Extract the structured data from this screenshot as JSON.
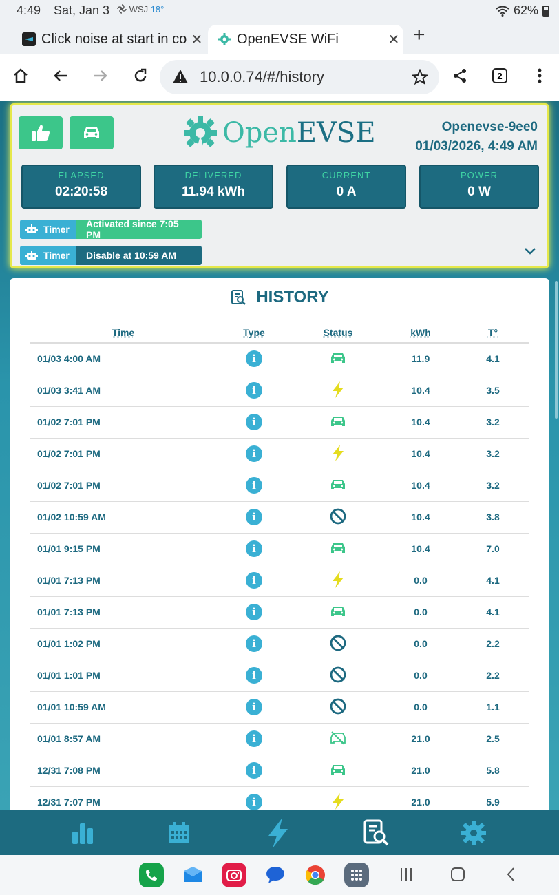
{
  "status_bar": {
    "time": "4:49",
    "date": "Sat, Jan 3",
    "weather_source": "WSJ",
    "temperature": "18°",
    "battery": "62%"
  },
  "tabs": [
    {
      "title": "Click noise at start in co",
      "active": false
    },
    {
      "title": "OpenEVSE WiFi",
      "active": true
    }
  ],
  "address_bar": {
    "url": "10.0.0.74/#/history",
    "tab_count": "2"
  },
  "header": {
    "logo_open": "Open",
    "logo_evse": "EVSE",
    "device_name": "Openevse-9ee0",
    "datetime": "01/03/2026, 4:49 AM",
    "stats": [
      {
        "label": "ELAPSED",
        "value": "02:20:58"
      },
      {
        "label": "DELIVERED",
        "value": "11.94 kWh"
      },
      {
        "label": "CURRENT",
        "value": "0 A"
      },
      {
        "label": "POWER",
        "value": "0 W"
      }
    ],
    "timers": [
      {
        "tag": "Timer",
        "text": "Activated since 7:05 PM"
      },
      {
        "tag": "Timer",
        "text": "Disable at 10:59 AM"
      }
    ]
  },
  "history": {
    "title": "HISTORY",
    "columns": [
      "Time",
      "Type",
      "Status",
      "kWh",
      "T°"
    ],
    "rows": [
      {
        "time": "01/03 4:00 AM",
        "type": "i",
        "status": "car-icon",
        "kwh": "11.9",
        "temp": "4.1"
      },
      {
        "time": "01/03 3:41 AM",
        "type": "i",
        "status": "bolt-icon",
        "kwh": "10.4",
        "temp": "3.5"
      },
      {
        "time": "01/02 7:01 PM",
        "type": "i",
        "status": "car-icon",
        "kwh": "10.4",
        "temp": "3.2"
      },
      {
        "time": "01/02 7:01 PM",
        "type": "i",
        "status": "bolt-icon",
        "kwh": "10.4",
        "temp": "3.2"
      },
      {
        "time": "01/02 7:01 PM",
        "type": "i",
        "status": "car-icon",
        "kwh": "10.4",
        "temp": "3.2"
      },
      {
        "time": "01/02 10:59 AM",
        "type": "i",
        "status": "disabled-icon",
        "kwh": "10.4",
        "temp": "3.8"
      },
      {
        "time": "01/01 9:15 PM",
        "type": "i",
        "status": "car-icon",
        "kwh": "10.4",
        "temp": "7.0"
      },
      {
        "time": "01/01 7:13 PM",
        "type": "i",
        "status": "bolt-icon",
        "kwh": "0.0",
        "temp": "4.1"
      },
      {
        "time": "01/01 7:13 PM",
        "type": "i",
        "status": "car-icon",
        "kwh": "0.0",
        "temp": "4.1"
      },
      {
        "time": "01/01 1:02 PM",
        "type": "i",
        "status": "disabled-icon",
        "kwh": "0.0",
        "temp": "2.2"
      },
      {
        "time": "01/01 1:01 PM",
        "type": "i",
        "status": "disabled-icon",
        "kwh": "0.0",
        "temp": "2.2"
      },
      {
        "time": "01/01 10:59 AM",
        "type": "i",
        "status": "disabled-icon",
        "kwh": "0.0",
        "temp": "1.1"
      },
      {
        "time": "01/01 8:57 AM",
        "type": "i",
        "status": "car-off-icon",
        "kwh": "21.0",
        "temp": "2.5"
      },
      {
        "time": "12/31 7:08 PM",
        "type": "i",
        "status": "car-icon",
        "kwh": "21.0",
        "temp": "5.8"
      },
      {
        "time": "12/31 7:07 PM",
        "type": "i",
        "status": "bolt-icon",
        "kwh": "21.0",
        "temp": "5.9"
      }
    ]
  },
  "app_nav": [
    "chart-icon",
    "calendar-icon",
    "bolt-icon",
    "history-icon",
    "gear-icon"
  ],
  "colors": {
    "primary": "#1d6b80",
    "accent_green": "#3cc68a",
    "accent_blue": "#3ab0d4",
    "bolt_yellow": "#e5dc1e",
    "highlight": "#e5e84a"
  }
}
